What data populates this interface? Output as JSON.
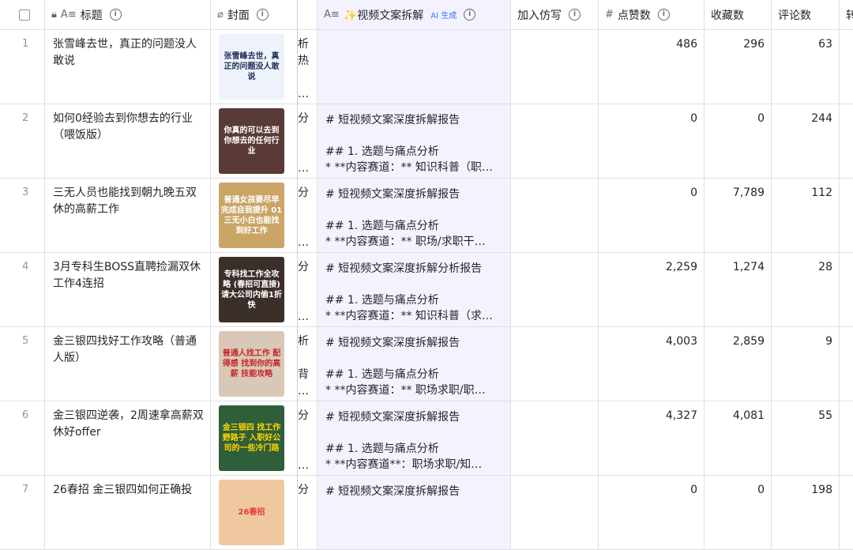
{
  "header": {
    "title_col": "标题",
    "cover_col": "封面",
    "breakdown_col": "✨视频文案拆解",
    "breakdown_badge": "AI 生成",
    "imitate_col": "加入仿写",
    "likes_col": "点赞数",
    "favs_col": "收藏数",
    "comments_col": "评论数",
    "extra_col": "转"
  },
  "rows": [
    {
      "idx": "1",
      "title": "张雪峰去世，真正的问题没人敢说",
      "cover_text": "张雪峰去世，真正的问题没人敢说",
      "frag": "析\n热\n\n…",
      "breakdown": "",
      "likes": "486",
      "favs": "296",
      "comments": "63"
    },
    {
      "idx": "2",
      "title": "如何0经验去到你想去的行业（喂饭版）",
      "cover_text": "你真的可以去到你想去的任何行业",
      "frag": "分\n\n\n…",
      "breakdown": "# 短视频文案深度拆解报告\n\n## 1. 选题与痛点分析\n* **内容赛道：** 知识科普（职…",
      "likes": "0",
      "favs": "0",
      "comments": "244"
    },
    {
      "idx": "3",
      "title": "三无人员也能找到朝九晚五双休的高薪工作",
      "cover_text": "普通女孩要尽早完成自我提升 01 三无小白也能找到好工作",
      "frag": "分\n\n\n…",
      "breakdown": "# 短视频文案深度拆解报告\n\n## 1. 选题与痛点分析\n* **内容赛道：** 职场/求职干…",
      "likes": "0",
      "favs": "7,789",
      "comments": "112"
    },
    {
      "idx": "4",
      "title": "3月专科生BOSS直聘捡漏双休工作4连招",
      "cover_text": "专科找工作全攻略 (春招可直接) 请大公司内偷1折快",
      "frag": "分\n\n\n…",
      "breakdown": "# 短视频文案深度拆解分析报告\n\n## 1. 选题与痛点分析\n* **内容赛道：** 知识科普（求…",
      "likes": "2,259",
      "favs": "1,274",
      "comments": "28"
    },
    {
      "idx": "5",
      "title": "金三银四找好工作攻略（普通人版）",
      "cover_text": "普通人找工作 配得感 找到你的高薪 技能攻略",
      "frag": "析\n\n背\n…",
      "breakdown": "# 短视频文案深度拆解报告\n\n## 1. 选题与痛点分析\n* **内容赛道：** 职场求职/职…",
      "likes": "4,003",
      "favs": "2,859",
      "comments": "9"
    },
    {
      "idx": "6",
      "title": "金三银四逆袭，2周速拿高薪双休好offer",
      "cover_text": "金三银四 找工作野路子 入职好公司的一些冷门路",
      "frag": "分\n\n\n…",
      "breakdown": "# 短视频文案深度拆解报告\n\n## 1. 选题与痛点分析\n* **内容赛道**：职场求职/知…",
      "likes": "4,327",
      "favs": "4,081",
      "comments": "55"
    },
    {
      "idx": "7",
      "title": "26春招 金三银四如何正确投",
      "cover_text": "26春招",
      "frag": "分",
      "breakdown": "# 短视频文案深度拆解报告",
      "likes": "0",
      "favs": "0",
      "comments": "198"
    }
  ],
  "colors": {
    "purple_bg": "#f5f2ff",
    "border": "#dee0e3",
    "ai": "#3370ff"
  }
}
